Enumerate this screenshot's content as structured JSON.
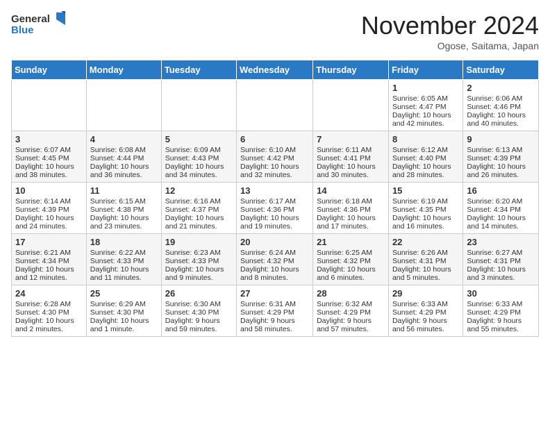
{
  "header": {
    "logo_general": "General",
    "logo_blue": "Blue",
    "month_title": "November 2024",
    "location": "Ogose, Saitama, Japan"
  },
  "weekdays": [
    "Sunday",
    "Monday",
    "Tuesday",
    "Wednesday",
    "Thursday",
    "Friday",
    "Saturday"
  ],
  "weeks": [
    [
      {
        "day": "",
        "info": ""
      },
      {
        "day": "",
        "info": ""
      },
      {
        "day": "",
        "info": ""
      },
      {
        "day": "",
        "info": ""
      },
      {
        "day": "",
        "info": ""
      },
      {
        "day": "1",
        "info": "Sunrise: 6:05 AM\nSunset: 4:47 PM\nDaylight: 10 hours and 42 minutes."
      },
      {
        "day": "2",
        "info": "Sunrise: 6:06 AM\nSunset: 4:46 PM\nDaylight: 10 hours and 40 minutes."
      }
    ],
    [
      {
        "day": "3",
        "info": "Sunrise: 6:07 AM\nSunset: 4:45 PM\nDaylight: 10 hours and 38 minutes."
      },
      {
        "day": "4",
        "info": "Sunrise: 6:08 AM\nSunset: 4:44 PM\nDaylight: 10 hours and 36 minutes."
      },
      {
        "day": "5",
        "info": "Sunrise: 6:09 AM\nSunset: 4:43 PM\nDaylight: 10 hours and 34 minutes."
      },
      {
        "day": "6",
        "info": "Sunrise: 6:10 AM\nSunset: 4:42 PM\nDaylight: 10 hours and 32 minutes."
      },
      {
        "day": "7",
        "info": "Sunrise: 6:11 AM\nSunset: 4:41 PM\nDaylight: 10 hours and 30 minutes."
      },
      {
        "day": "8",
        "info": "Sunrise: 6:12 AM\nSunset: 4:40 PM\nDaylight: 10 hours and 28 minutes."
      },
      {
        "day": "9",
        "info": "Sunrise: 6:13 AM\nSunset: 4:39 PM\nDaylight: 10 hours and 26 minutes."
      }
    ],
    [
      {
        "day": "10",
        "info": "Sunrise: 6:14 AM\nSunset: 4:39 PM\nDaylight: 10 hours and 24 minutes."
      },
      {
        "day": "11",
        "info": "Sunrise: 6:15 AM\nSunset: 4:38 PM\nDaylight: 10 hours and 23 minutes."
      },
      {
        "day": "12",
        "info": "Sunrise: 6:16 AM\nSunset: 4:37 PM\nDaylight: 10 hours and 21 minutes."
      },
      {
        "day": "13",
        "info": "Sunrise: 6:17 AM\nSunset: 4:36 PM\nDaylight: 10 hours and 19 minutes."
      },
      {
        "day": "14",
        "info": "Sunrise: 6:18 AM\nSunset: 4:36 PM\nDaylight: 10 hours and 17 minutes."
      },
      {
        "day": "15",
        "info": "Sunrise: 6:19 AM\nSunset: 4:35 PM\nDaylight: 10 hours and 16 minutes."
      },
      {
        "day": "16",
        "info": "Sunrise: 6:20 AM\nSunset: 4:34 PM\nDaylight: 10 hours and 14 minutes."
      }
    ],
    [
      {
        "day": "17",
        "info": "Sunrise: 6:21 AM\nSunset: 4:34 PM\nDaylight: 10 hours and 12 minutes."
      },
      {
        "day": "18",
        "info": "Sunrise: 6:22 AM\nSunset: 4:33 PM\nDaylight: 10 hours and 11 minutes."
      },
      {
        "day": "19",
        "info": "Sunrise: 6:23 AM\nSunset: 4:33 PM\nDaylight: 10 hours and 9 minutes."
      },
      {
        "day": "20",
        "info": "Sunrise: 6:24 AM\nSunset: 4:32 PM\nDaylight: 10 hours and 8 minutes."
      },
      {
        "day": "21",
        "info": "Sunrise: 6:25 AM\nSunset: 4:32 PM\nDaylight: 10 hours and 6 minutes."
      },
      {
        "day": "22",
        "info": "Sunrise: 6:26 AM\nSunset: 4:31 PM\nDaylight: 10 hours and 5 minutes."
      },
      {
        "day": "23",
        "info": "Sunrise: 6:27 AM\nSunset: 4:31 PM\nDaylight: 10 hours and 3 minutes."
      }
    ],
    [
      {
        "day": "24",
        "info": "Sunrise: 6:28 AM\nSunset: 4:30 PM\nDaylight: 10 hours and 2 minutes."
      },
      {
        "day": "25",
        "info": "Sunrise: 6:29 AM\nSunset: 4:30 PM\nDaylight: 10 hours and 1 minute."
      },
      {
        "day": "26",
        "info": "Sunrise: 6:30 AM\nSunset: 4:30 PM\nDaylight: 9 hours and 59 minutes."
      },
      {
        "day": "27",
        "info": "Sunrise: 6:31 AM\nSunset: 4:29 PM\nDaylight: 9 hours and 58 minutes."
      },
      {
        "day": "28",
        "info": "Sunrise: 6:32 AM\nSunset: 4:29 PM\nDaylight: 9 hours and 57 minutes."
      },
      {
        "day": "29",
        "info": "Sunrise: 6:33 AM\nSunset: 4:29 PM\nDaylight: 9 hours and 56 minutes."
      },
      {
        "day": "30",
        "info": "Sunrise: 6:33 AM\nSunset: 4:29 PM\nDaylight: 9 hours and 55 minutes."
      }
    ]
  ]
}
